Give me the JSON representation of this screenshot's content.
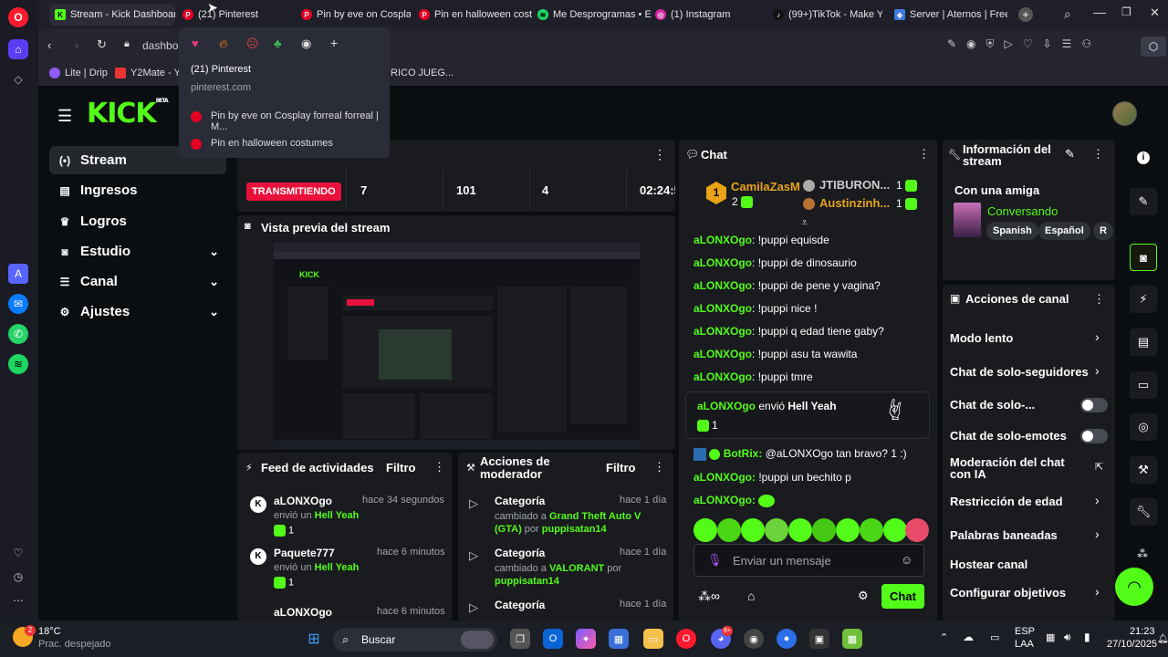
{
  "browser": {
    "tabs": [
      {
        "label": "Stream - Kick Dashboard",
        "fav": "K",
        "color": "#53fc18",
        "active": true
      },
      {
        "label": "(21) Pinterest",
        "fav": "P",
        "color": "#e60023"
      },
      {
        "label": "Pin by eve on Cosplay f",
        "fav": "P",
        "color": "#e60023"
      },
      {
        "label": "Pin en halloween costu",
        "fav": "P",
        "color": "#e60023"
      },
      {
        "label": "Me Desprogramas • Ele",
        "fav": "♪",
        "color": "#1ed760"
      },
      {
        "label": "(1) Instagram",
        "fav": "◎",
        "color": "#d6249f"
      },
      {
        "label": "(99+)TikTok - Make You",
        "fav": "♪",
        "color": "#222"
      },
      {
        "label": "Server | Aternos | Free M",
        "fav": "◆",
        "color": "#3d7be0"
      }
    ],
    "address": "dashboa",
    "bookmarks": [
      "Lite | Drip",
      "Y2Mate - Yo",
      "RICO JUEG..."
    ],
    "dropdown": {
      "title": "(21) Pinterest",
      "url": "pinterest.com",
      "items": [
        "Pin by eve on Cosplay forreal forreal | M...",
        "Pin en halloween costumes"
      ]
    }
  },
  "kick": {
    "logo": "KICK",
    "logo_sup": "BETA",
    "sidebar": [
      {
        "label": "Stream",
        "icon": "(•)"
      },
      {
        "label": "Ingresos",
        "icon": "▤"
      },
      {
        "label": "Logros",
        "icon": "♛"
      },
      {
        "label": "Estudio",
        "icon": "◙"
      },
      {
        "label": "Canal",
        "icon": "☰"
      },
      {
        "label": "Ajustes",
        "icon": "⚙"
      }
    ],
    "stats": {
      "status": "TRANSMITIENDO",
      "viewers": "7",
      "followers": "101",
      "subs": "4",
      "time": "02:24:5"
    },
    "preview_title": "Vista previa del stream",
    "feed": {
      "title": "Feed de actividades",
      "filter": "Filtro",
      "items": [
        {
          "user": "aLONXOgo",
          "time": "hace 34 segundos",
          "pre": "envió un",
          "gift": "Hell Yeah",
          "count": "1"
        },
        {
          "user": "Paquete777",
          "time": "hace 6 minutos",
          "pre": "envió un",
          "gift": "Hell Yeah",
          "count": "1"
        },
        {
          "user": "aLONXOgo",
          "time": "hace 6 minutos",
          "pre": "",
          "gift": "",
          "count": ""
        }
      ]
    },
    "mod": {
      "title": "Acciones de moderador",
      "filter": "Filtro",
      "items": [
        {
          "label": "Categoría",
          "time": "hace 1 día",
          "pre": "cambiado a",
          "value": "Grand Theft Auto V (GTA)",
          "by": "por",
          "user": "puppisatan14"
        },
        {
          "label": "Categoría",
          "time": "hace 1 día",
          "pre": "cambiado a",
          "value": "VALORANT",
          "by": "por",
          "user": "puppisatan14"
        },
        {
          "label": "Categoría",
          "time": "hace 1 día",
          "pre": "",
          "value": "",
          "by": "",
          "user": ""
        }
      ]
    },
    "chat": {
      "title": "Chat",
      "top": [
        {
          "rank": "1",
          "user": "CamilaZasM"
        },
        {
          "rank": "2",
          "user": "JTIBURON..."
        },
        {
          "rank": "",
          "user": "Austinzinh..."
        }
      ],
      "top_counts": [
        "1",
        "1"
      ],
      "messages": [
        {
          "user": "aLONXOgo",
          "text": "!puppi equisde"
        },
        {
          "user": "aLONXOgo",
          "text": "!puppi de dinosaurio"
        },
        {
          "user": "aLONXOgo",
          "text": "!puppi de pene y vagina?"
        },
        {
          "user": "aLONXOgo",
          "text": "!puppi nice !"
        },
        {
          "user": "aLONXOgo",
          "text": "!puppi q edad tiene gaby?"
        },
        {
          "user": "aLONXOgo",
          "text": "!puppi asu ta wawita"
        },
        {
          "user": "aLONXOgo",
          "text": "!puppi tmre"
        }
      ],
      "gift": {
        "user": "aLONXOgo",
        "text": "envió",
        "name": "Hell Yeah",
        "count": "1"
      },
      "bot": {
        "user": "BotRix:",
        "text": "@aLONXOgo tan bravo? 1 :)"
      },
      "msg2": [
        {
          "user": "aLONXOgo:",
          "text": "!puppi un bechito p"
        },
        {
          "user": "aLONXOgo:",
          "text": ""
        }
      ],
      "placeholder": "Enviar un mensaje",
      "send": "Chat"
    },
    "info": {
      "title": "Información del stream",
      "stream_title": "Con una amiga",
      "category": "Conversando",
      "tags": [
        "Spanish",
        "Español",
        "R"
      ]
    },
    "actions": {
      "title": "Acciones de canal",
      "rows": [
        "Modo lento",
        "Chat de solo-seguidores",
        "Chat de solo-...",
        "Chat de solo-emotes",
        "Moderación del chat con IA",
        "Restricción de edad",
        "Palabras baneadas",
        "Hostear canal",
        "Configurar objetivos"
      ]
    }
  },
  "taskbar": {
    "weather_temp": "18°C",
    "weather_desc": "Prac. despejado",
    "search": "Buscar",
    "lang": "ESP",
    "lang2": "LAA",
    "time": "21:23",
    "date": "27/10/2025",
    "weather_badge": "2",
    "discord_badge": "9+"
  },
  "colors": {
    "accent": "#53fc18",
    "live": "#e9113c",
    "panel": "#191b1f"
  }
}
